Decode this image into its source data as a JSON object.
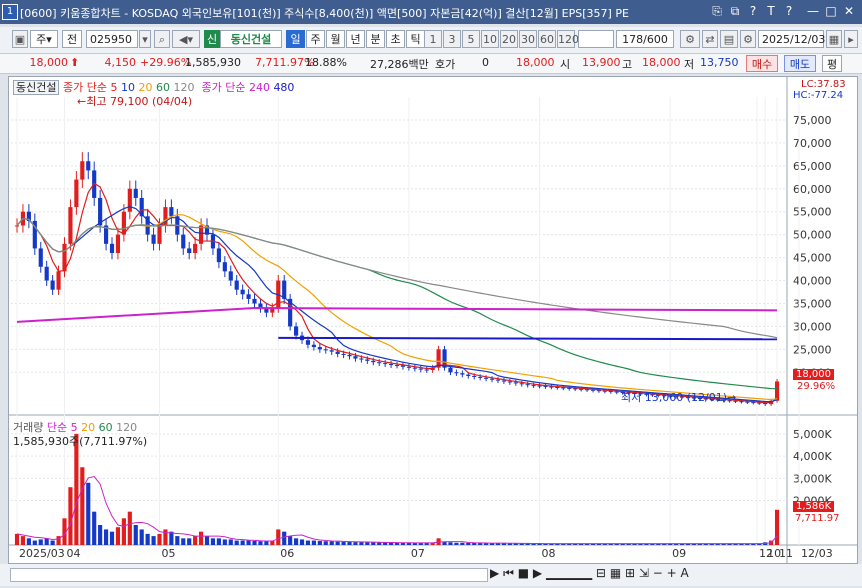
{
  "window": {
    "number": "1",
    "title": "[0600] 키움종합차트 - KOSDAQ 외국인보유[101(천)] 주식수[8,400(천)] 액면[500] 자본금[42(억)] 결산[12월] EPS[357] PE",
    "controls": [
      "⎘",
      "⧉",
      "?",
      "T",
      "?",
      "—",
      "□",
      "✕"
    ]
  },
  "toolbar": {
    "stock_label": "주",
    "prev_label": "전",
    "stock_code": "025950",
    "stock_name": "동신건설",
    "new_badge": "신",
    "periods": [
      "일",
      "주",
      "월",
      "년",
      "분",
      "초",
      "틱"
    ],
    "selected_period": "일",
    "minute_options": [
      "1",
      "3",
      "5",
      "10",
      "20",
      "30",
      "60",
      "120"
    ],
    "page_counter": "178/600",
    "date": "2025/12/03"
  },
  "quote": {
    "price": "18,000",
    "change": "4,150",
    "change_pct": "+29.96%",
    "volume": "1,585,930",
    "volume_ratio": "7,711.97%",
    "turnover": "18.88%",
    "amount": "27,286백만",
    "hoga_label": "호가",
    "hoga_value": "0",
    "hoga_price": "18,000",
    "open_label": "시",
    "open": "13,900",
    "high_label": "고",
    "high": "18,000",
    "low_label": "저",
    "low": "13,750",
    "buy_label": "매수",
    "sell_label": "매도",
    "avg_label": "평"
  },
  "price_panel": {
    "name_tab": "동신건설",
    "legend_ma_label": "종가 단순",
    "legend_ma_periods": [
      "5",
      "10",
      "20",
      "60",
      "120"
    ],
    "legend_ma240_label": "종가 단순 240",
    "legend_ma480": "480",
    "lc": "LC:37.83",
    "hc": "HC:-77.24",
    "high_marker": "최고 79,100 (04/04)",
    "low_marker": "최저 13,060 (12/01)",
    "price_tag": "18,000",
    "pct_tag": "29.96%"
  },
  "volume_panel": {
    "legend_label": "거래량",
    "legend_ma_label": "단순",
    "legend_ma_periods": [
      "5",
      "20",
      "60",
      "120"
    ],
    "value_text": "1,585,930주(7,711.97%)",
    "volume_tag": "1,586K",
    "pct_tag": "7,711.97"
  },
  "x_axis_labels": [
    "2025/03",
    "04",
    "05",
    "06",
    "07",
    "08",
    "09",
    "10",
    "11",
    "12",
    "12/03"
  ],
  "colors": {
    "up": "#e21d1d",
    "down": "#1438c8",
    "ma5": "#e21d1d",
    "ma10": "#1438c8",
    "ma20": "#f0a000",
    "ma60": "#1f8a4c",
    "ma120": "#888888",
    "ma240": "#cc22cc",
    "ma480": "#1a1ac8"
  },
  "chart_data": {
    "type": "candlestick",
    "y_ticks": [
      "75,000",
      "70,000",
      "65,000",
      "60,000",
      "55,000",
      "50,000",
      "45,000",
      "40,000",
      "35,000",
      "30,000",
      "25,000",
      "20,000"
    ],
    "volume_ticks": [
      "5,000K",
      "4,000K",
      "3,000K",
      "2,000K"
    ],
    "ylim": [
      12000,
      80000
    ],
    "vol_ylim": [
      0,
      5400
    ],
    "closes": [
      52000,
      55000,
      53000,
      47000,
      43000,
      40000,
      38000,
      42000,
      48000,
      56000,
      62000,
      66000,
      64000,
      58000,
      52000,
      48000,
      46000,
      50000,
      55000,
      60000,
      58000,
      54000,
      50000,
      48000,
      52000,
      56000,
      54000,
      50000,
      47000,
      46000,
      48000,
      52000,
      50000,
      47000,
      44000,
      42000,
      40000,
      38000,
      37000,
      36000,
      35000,
      34000,
      33000,
      34000,
      40000,
      36000,
      30000,
      28000,
      27000,
      26000,
      25500,
      25000,
      24800,
      24500,
      24000,
      23800,
      23500,
      23000,
      22800,
      22500,
      22200,
      22000,
      21800,
      21600,
      21500,
      21200,
      21000,
      20800,
      20600,
      20500,
      21000,
      25000,
      21000,
      20000,
      19800,
      19500,
      19200,
      19000,
      18800,
      18600,
      18400,
      18200,
      18000,
      17800,
      17600,
      17400,
      17200,
      17100,
      17000,
      16900,
      16800,
      16700,
      16600,
      16500,
      16400,
      16300,
      16200,
      16100,
      16000,
      15900,
      15800,
      15700,
      15600,
      15500,
      15400,
      15300,
      15200,
      15100,
      15000,
      14900,
      14800,
      14700,
      14600,
      14500,
      14400,
      14300,
      14200,
      14100,
      14000,
      13900,
      13800,
      13700,
      13600,
      13500,
      13400,
      13300,
      13060,
      13800,
      18000
    ],
    "volumes": [
      500,
      400,
      300,
      200,
      250,
      300,
      200,
      400,
      1200,
      2600,
      5000,
      3500,
      2800,
      1500,
      900,
      700,
      600,
      800,
      1200,
      1500,
      900,
      700,
      500,
      400,
      500,
      700,
      600,
      400,
      300,
      300,
      400,
      600,
      400,
      300,
      300,
      250,
      250,
      200,
      200,
      200,
      180,
      170,
      160,
      180,
      700,
      600,
      400,
      300,
      250,
      200,
      200,
      180,
      170,
      160,
      150,
      150,
      140,
      130,
      130,
      120,
      120,
      110,
      110,
      100,
      100,
      100,
      100,
      90,
      90,
      90,
      100,
      300,
      150,
      120,
      100,
      100,
      90,
      90,
      90,
      80,
      80,
      80,
      80,
      70,
      70,
      70,
      70,
      60,
      60,
      60,
      60,
      60,
      60,
      60,
      60,
      60,
      60,
      60,
      60,
      60,
      60,
      60,
      60,
      60,
      60,
      60,
      60,
      60,
      60,
      60,
      60,
      60,
      60,
      60,
      60,
      60,
      60,
      60,
      60,
      60,
      60,
      60,
      60,
      60,
      60,
      60,
      120,
      200,
      1586
    ]
  }
}
